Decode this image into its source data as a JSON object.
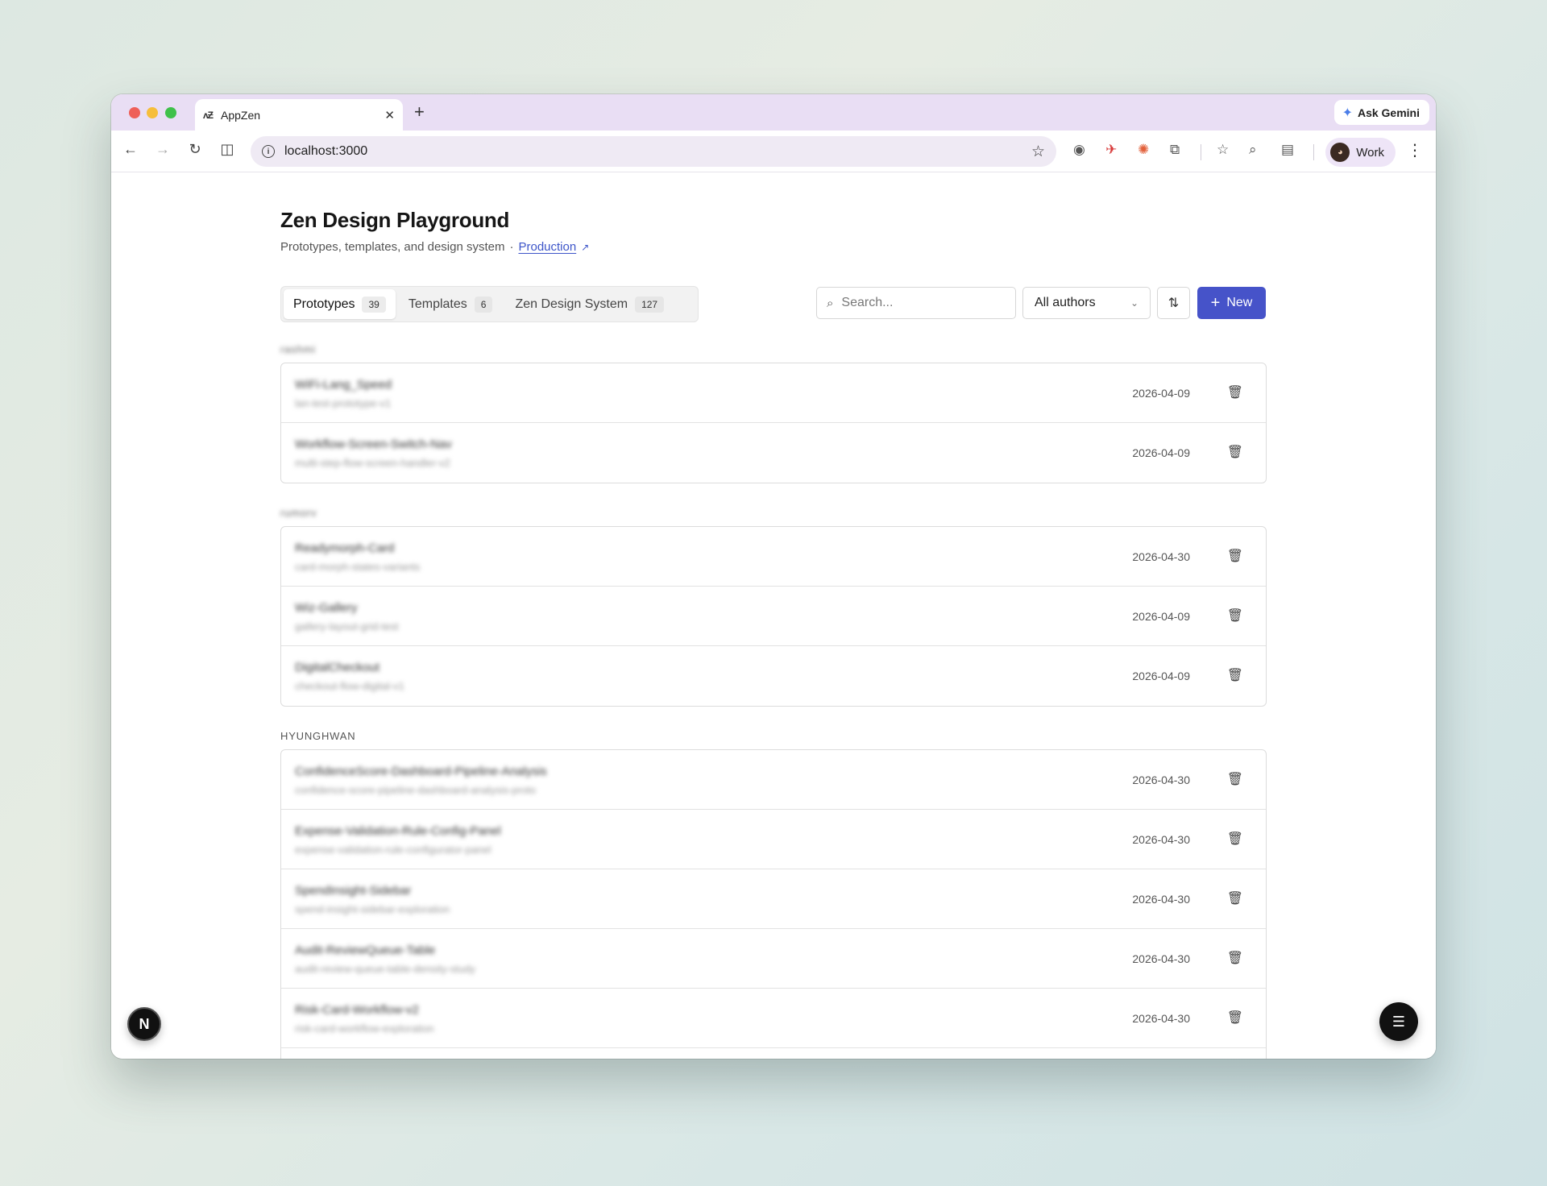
{
  "browser": {
    "tab_title": "AppZen",
    "tab_favicon": "ʌƵ",
    "new_tab": "+",
    "close_tab": "✕",
    "gemini_label": "Ask Gemini",
    "url": "localhost:3000",
    "profile_name": "Work",
    "icons": {
      "back": "back-arrow-icon",
      "forward": "forward-arrow-icon",
      "reload": "reload-icon",
      "split": "split-view-icon",
      "info": "site-info-icon",
      "bookmark": "star-icon",
      "camera": "camera-icon",
      "ext1": "bird-extension-icon",
      "ext2": "sun-extension-icon",
      "extensions": "puzzle-icon",
      "bookmarks": "bookmark-star-icon",
      "lens": "lens-search-icon",
      "reading": "reading-list-icon",
      "menu": "more-vert-icon"
    }
  },
  "page": {
    "title": "Zen Design Playground",
    "subtitle": "Prototypes, templates, and design system",
    "separator": "·",
    "production_link": "Production"
  },
  "tabs": [
    {
      "label": "Prototypes",
      "count": "39",
      "active": true
    },
    {
      "label": "Templates",
      "count": "6",
      "active": false
    },
    {
      "label": "Zen Design System",
      "count": "127",
      "active": false
    }
  ],
  "controls": {
    "search_placeholder": "Search...",
    "authors_value": "All authors",
    "new_label": "New"
  },
  "groups": [
    {
      "label": "rashmi",
      "rows": [
        {
          "title": "WiFi-Lang_Speed",
          "subtitle": "lan-test-prototype-v1",
          "date": "2026-04-09"
        },
        {
          "title": "Workflow-Screen-Switch-Nav",
          "subtitle": "multi-step-flow-screen-handler-v2",
          "date": "2026-04-09"
        }
      ]
    },
    {
      "label": "rumorv",
      "rows": [
        {
          "title": "Readymorph-Card",
          "subtitle": "card-morph-states-variants",
          "date": "2026-04-30"
        },
        {
          "title": "Wiz-Gallery",
          "subtitle": "gallery-layout-grid-test",
          "date": "2026-04-09"
        },
        {
          "title": "DigitalCheckout",
          "subtitle": "checkout-flow-digital-v1",
          "date": "2026-04-09"
        }
      ]
    },
    {
      "label": "HYUNGHWAN",
      "rows": [
        {
          "title": "ConfidenceScore-Dashboard-Pipeline-Analysis",
          "subtitle": "confidence-score-pipeline-dashboard-analysis-proto",
          "date": "2026-04-30"
        },
        {
          "title": "Expense-Validation-Rule-Config-Panel",
          "subtitle": "expense-validation-rule-configurator-panel",
          "date": "2026-04-30"
        },
        {
          "title": "SpendInsight-Sidebar",
          "subtitle": "spend-insight-sidebar-exploration",
          "date": "2026-04-30"
        },
        {
          "title": "Audit-ReviewQueue-Table",
          "subtitle": "audit-review-queue-table-density-study",
          "date": "2026-04-30"
        },
        {
          "title": "Risk-Card-Workflow-v2",
          "subtitle": "risk-card-workflow-exploration",
          "date": "2026-04-30"
        }
      ]
    }
  ],
  "floating": {
    "next_badge": "N"
  },
  "colors": {
    "accent": "#4653c9",
    "link": "#3d55c9",
    "tabstrip": "#e9def4"
  }
}
